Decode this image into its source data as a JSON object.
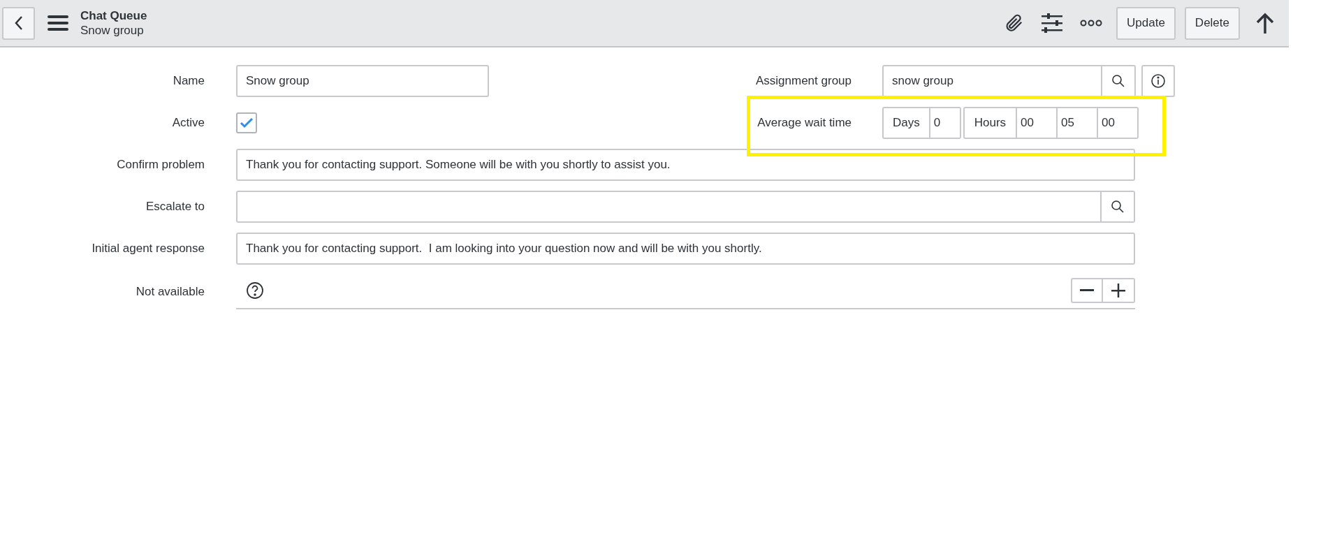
{
  "header": {
    "title": "Chat Queue",
    "subtitle": "Snow group",
    "buttons": [
      "Update",
      "Delete"
    ]
  },
  "name": {
    "label": "Name",
    "value": "Snow group"
  },
  "assignment_group": {
    "label": "Assignment group",
    "value": "snow group"
  },
  "active": {
    "label": "Active",
    "checked": true
  },
  "average_wait_time": {
    "label": "Average wait time",
    "days_label": "Days",
    "days": "0",
    "hours_label": "Hours",
    "hours": "00",
    "minutes": "05",
    "seconds": "00"
  },
  "rows": [
    {
      "kind": "text",
      "label": "Confirm problem",
      "value": "Thank you for contacting support. Someone will be with you shortly to assist you."
    },
    {
      "kind": "lookup",
      "label": "Escalate to",
      "value": ""
    },
    {
      "kind": "text",
      "label": "Initial agent response",
      "value": "Thank you for contacting support.  I am looking into your question now and will be with you shortly."
    },
    {
      "kind": "list",
      "label": "Not available",
      "value": ""
    }
  ]
}
